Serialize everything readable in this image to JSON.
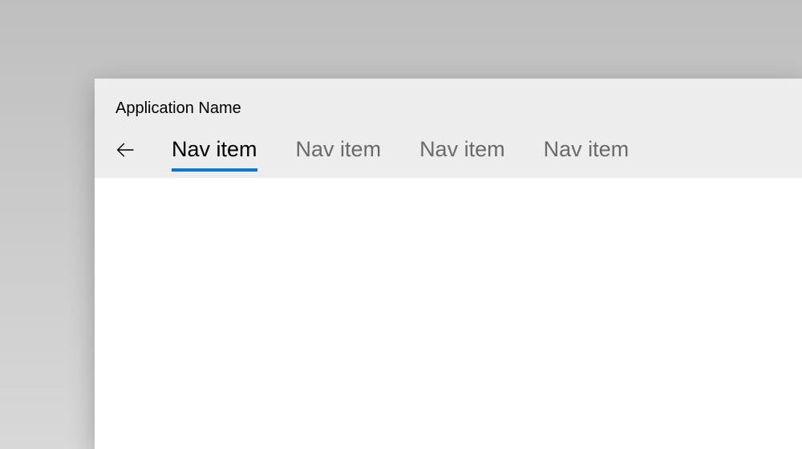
{
  "app": {
    "title": "Application Name"
  },
  "nav": {
    "items": [
      {
        "label": "Nav item",
        "active": true
      },
      {
        "label": "Nav item",
        "active": false
      },
      {
        "label": "Nav item",
        "active": false
      },
      {
        "label": "Nav item",
        "active": false
      }
    ]
  },
  "colors": {
    "accent": "#0078d4"
  }
}
